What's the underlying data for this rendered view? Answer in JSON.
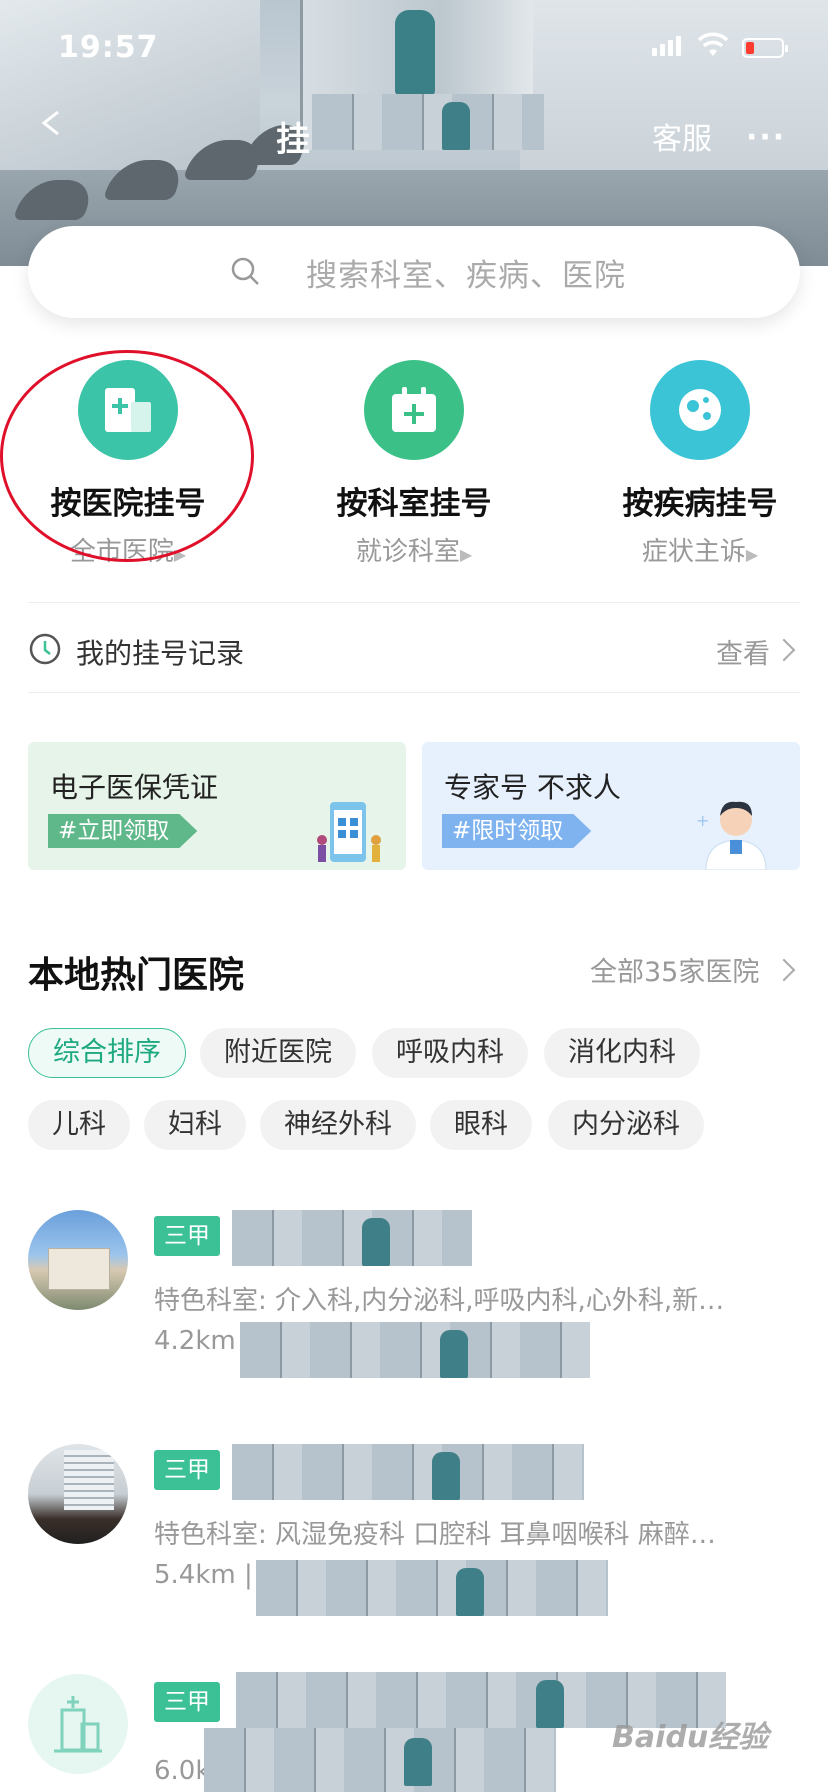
{
  "status_bar": {
    "time": "19:57"
  },
  "nav": {
    "title": "挂",
    "service_label": "客服",
    "more_label": "···"
  },
  "search": {
    "placeholder": "搜索科室、疾病、医院"
  },
  "categories": [
    {
      "title": "按医院挂号",
      "subtitle": "全市医院",
      "icon": "hospital-plus-icon",
      "color": "#3cc4a8"
    },
    {
      "title": "按科室挂号",
      "subtitle": "就诊科室",
      "icon": "calendar-plus-icon",
      "color": "#3bc188"
    },
    {
      "title": "按疾病挂号",
      "subtitle": "症状主诉",
      "icon": "virus-icon",
      "color": "#3bc3d6"
    }
  ],
  "record": {
    "label": "我的挂号记录",
    "view_label": "查看"
  },
  "banners": [
    {
      "title": "电子医保凭证",
      "tag": "#立即领取",
      "bg": "#e6f4ea",
      "tag_color": "#5fb88a"
    },
    {
      "title": "专家号 不求人",
      "tag": "#限时领取",
      "bg": "#e7f1fd",
      "tag_color": "#7fb3ef"
    }
  ],
  "section": {
    "title": "本地热门医院",
    "more_label": "全部35家医院"
  },
  "filters_row1": [
    "综合排序",
    "附近医院",
    "呼吸内科",
    "消化内科"
  ],
  "filters_row2": [
    "儿科",
    "妇科",
    "神经外科",
    "眼科",
    "内分泌科"
  ],
  "hospitals": [
    {
      "level": "三甲",
      "specialties": "特色科室: 介入科,内分泌科,呼吸内科,心外科,新…",
      "distance": "4.2km"
    },
    {
      "level": "三甲",
      "specialties": "特色科室: 风湿免疫科 口腔科 耳鼻咽喉科 麻醉…",
      "distance": "5.4km |"
    },
    {
      "level": "三甲",
      "specialties": "",
      "distance": "6.0k"
    }
  ],
  "watermark": "Baidu经验"
}
